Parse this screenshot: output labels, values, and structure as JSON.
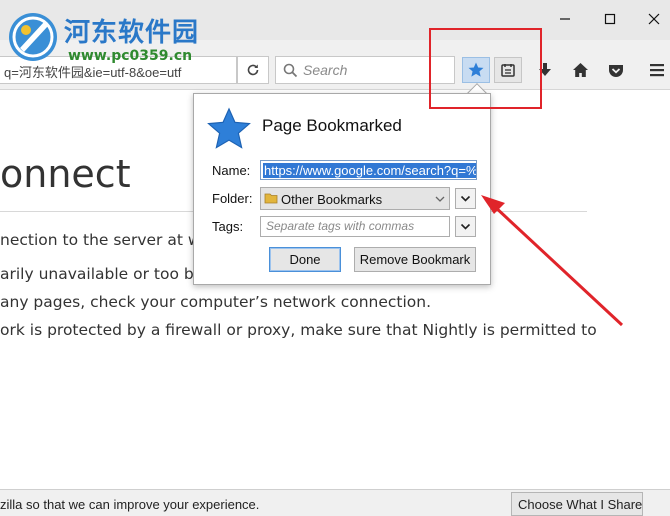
{
  "watermark": {
    "title": "河东软件园",
    "url": "www.pc0359.cn"
  },
  "nav": {
    "url_value": "q=河东软件园&ie=utf-8&oe=utf",
    "search_placeholder": "Search"
  },
  "page": {
    "heading": "onnect",
    "lines": [
      "nection to the server at ww",
      "arily unavailable or too bus",
      "any pages, check your computer’s network connection.",
      "ork is protected by a firewall or proxy, make sure that Nightly is permitted to"
    ]
  },
  "popup": {
    "title": "Page Bookmarked",
    "name_label": "Name:",
    "name_value": "https://www.google.com/search?q=%",
    "folder_label": "Folder:",
    "folder_value": "Other Bookmarks",
    "tags_label": "Tags:",
    "tags_placeholder": "Separate tags with commas",
    "done_label": "Done",
    "remove_label": "Remove Bookmark"
  },
  "notification": {
    "text": "zilla so that we can improve your experience.",
    "button_label": "Choose What I Share"
  },
  "colors": {
    "highlight": "#e0242a",
    "star": "#2e7fd8",
    "selection": "#3178d4"
  },
  "icons": [
    "logo-icon",
    "minimize-icon",
    "maximize-icon",
    "close-icon",
    "reload-icon",
    "search-icon",
    "bookmark-star-icon",
    "reading-list-icon",
    "download-icon",
    "home-icon",
    "pocket-icon",
    "menu-icon",
    "chevron-down-icon",
    "folder-icon"
  ]
}
